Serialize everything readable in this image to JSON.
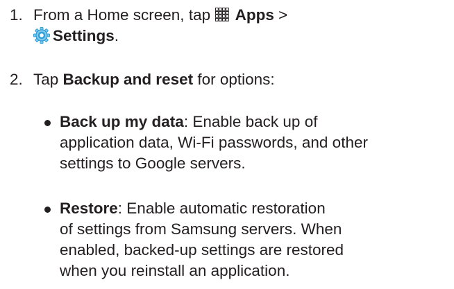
{
  "steps": [
    {
      "number": "1.",
      "pre": "From a Home screen, tap ",
      "apps_label": "Apps",
      "sep": " >",
      "settings_label": "Settings",
      "end": "."
    },
    {
      "number": "2.",
      "pre": "Tap ",
      "bold": "Backup and reset",
      "post": " for options:"
    }
  ],
  "options": [
    {
      "title": "Back up my data",
      "lines": [
        ": Enable back up of",
        "application data, Wi-Fi passwords, and other",
        "settings to Google servers."
      ]
    },
    {
      "title": "Restore",
      "lines": [
        ": Enable automatic restoration",
        "of settings from Samsung servers. When",
        "enabled, backed-up settings are restored",
        "when you reinstall an application."
      ]
    }
  ],
  "icons": {
    "apps": "apps-grid-icon",
    "settings": "settings-gear-icon"
  },
  "colors": {
    "text": "#231f20",
    "settings_icon": "#2f9fd8"
  }
}
